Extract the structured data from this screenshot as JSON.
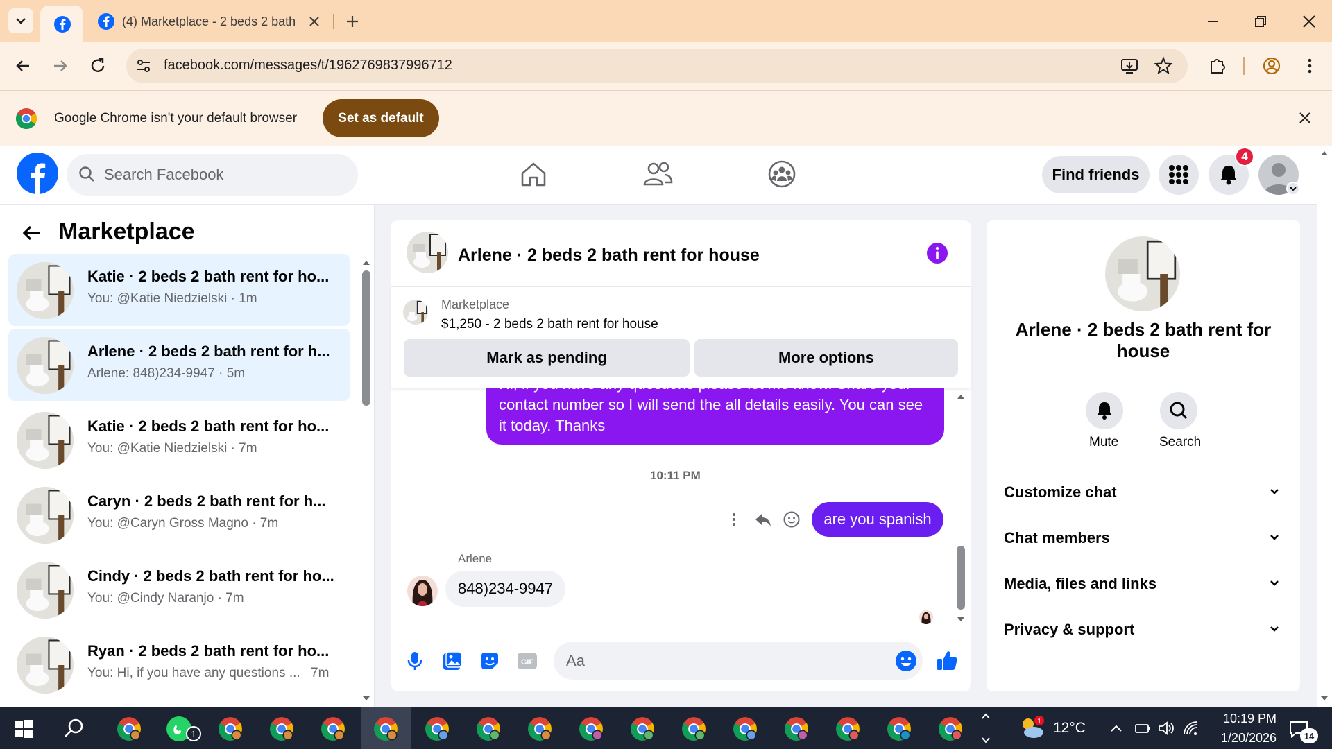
{
  "browser": {
    "tab_title": "(4) Marketplace - 2 beds 2 bath",
    "url": "facebook.com/messages/t/1962769837996712",
    "infobar_text": "Google Chrome isn't your default browser",
    "set_default_label": "Set as default"
  },
  "facebook": {
    "search_placeholder": "Search Facebook",
    "find_friends_label": "Find friends",
    "notification_count": "4"
  },
  "sidebar": {
    "title": "Marketplace",
    "conversations": [
      {
        "title": "Katie · 2 beds 2 bath rent for ho...",
        "subtitle": "You: @Katie Niedzielski · 1m",
        "selected": true
      },
      {
        "title": "Arlene · 2 beds 2 bath rent for h...",
        "subtitle": "Arlene: 848)234-9947 · 5m",
        "selected": true
      },
      {
        "title": "Katie · 2 beds 2 bath rent for ho...",
        "subtitle": "You: @Katie Niedzielski · 7m",
        "selected": false
      },
      {
        "title": "Caryn · 2 beds 2 bath rent for h...",
        "subtitle": "You: @Caryn Gross Magno · 7m",
        "selected": false
      },
      {
        "title": "Cindy · 2 beds 2 bath rent for ho...",
        "subtitle": "You: @Cindy Naranjo · 7m",
        "selected": false
      },
      {
        "title": "Ryan · 2 beds 2 bath rent for ho...",
        "subtitle": "You: Hi, if you have any questions ...",
        "time": "7m",
        "selected": false
      }
    ]
  },
  "chat": {
    "title": "Arlene · 2 beds 2 bath rent for house",
    "marketplace_label": "Marketplace",
    "listing": "$1,250 - 2 beds 2 bath rent for house",
    "mark_pending_label": "Mark as pending",
    "more_options_label": "More options",
    "messages": {
      "outgoing_partial_1": "Hi, if you have any questions please let me know. Share your",
      "outgoing_partial_2": "contact number so I will send the all details easily. You can see",
      "outgoing_partial_3": "it today. Thanks",
      "time": "10:11 PM",
      "outgoing_2": "are you spanish",
      "incoming_sender": "Arlene",
      "incoming_1": "848)234-9947"
    },
    "composer_placeholder": "Aa"
  },
  "details": {
    "title": "Arlene · 2 beds 2 bath rent for house",
    "mute_label": "Mute",
    "search_label": "Search",
    "sections": [
      "Customize chat",
      "Chat members",
      "Media, files and links",
      "Privacy & support"
    ]
  },
  "taskbar": {
    "weather": "12°C",
    "time": "10:19 PM",
    "date": "1/20/2026",
    "whatsapp_badge": "1",
    "notification_badge": "14"
  },
  "colors": {
    "facebook_blue": "#0866ff",
    "messenger_purple": "#8a16f0",
    "chrome_tab_strip": "#fbd9b6",
    "set_default_brown": "#7a4a10"
  }
}
